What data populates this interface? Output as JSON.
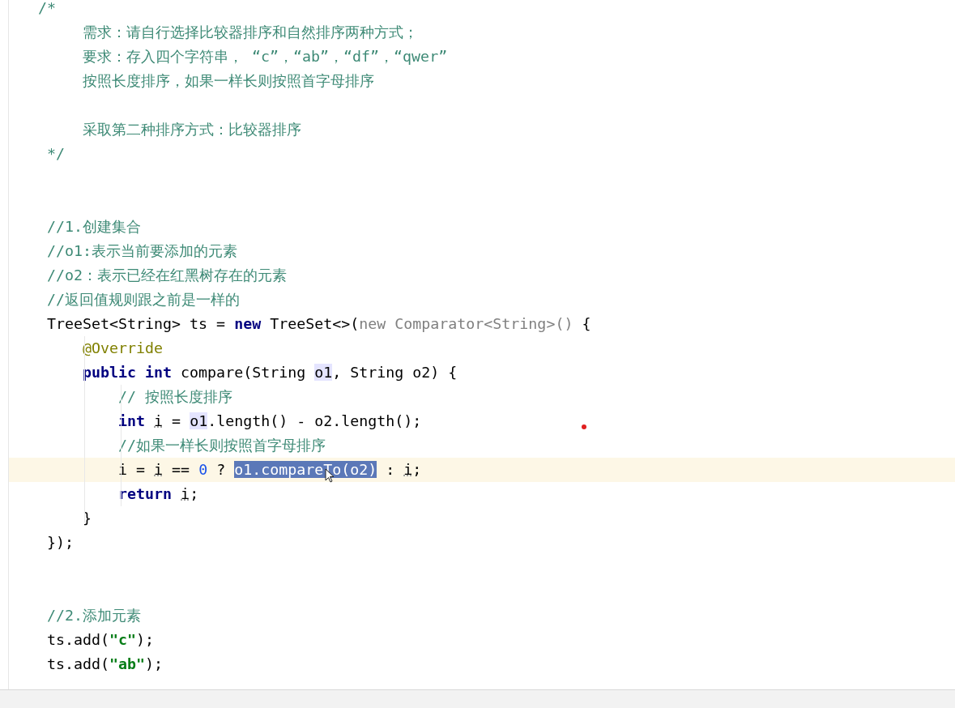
{
  "editor": {
    "lines": [
      {
        "kind": "code",
        "tokens": [
          {
            "kind": "comment",
            "text": "/*"
          }
        ]
      },
      {
        "kind": "code",
        "tokens": [
          {
            "kind": "comment",
            "text": "     需求：请自行选择比较器排序和自然排序两种方式；"
          }
        ]
      },
      {
        "kind": "code",
        "tokens": [
          {
            "kind": "comment",
            "text": "     要求：存入四个字符串， “c”，“ab”，“df”，“qwer”"
          }
        ]
      },
      {
        "kind": "code",
        "tokens": [
          {
            "kind": "comment",
            "text": "     按照长度排序，如果一样长则按照首字母排序"
          }
        ]
      },
      {
        "kind": "blank"
      },
      {
        "kind": "code",
        "tokens": [
          {
            "kind": "comment",
            "text": "     采取第二种排序方式：比较器排序"
          }
        ]
      },
      {
        "kind": "code",
        "tokens": [
          {
            "kind": "comment",
            "text": " */"
          }
        ]
      },
      {
        "kind": "blank"
      },
      {
        "kind": "blank"
      },
      {
        "kind": "code",
        "tokens": [
          {
            "kind": "comment",
            "text": " //1.创建集合"
          }
        ]
      },
      {
        "kind": "code",
        "tokens": [
          {
            "kind": "comment",
            "text": " //o1:表示当前要添加的元素"
          }
        ]
      },
      {
        "kind": "code",
        "tokens": [
          {
            "kind": "comment",
            "text": " //o2：表示已经在红黑树存在的元素"
          }
        ]
      },
      {
        "kind": "code",
        "tokens": [
          {
            "kind": "comment",
            "text": " //返回值规则跟之前是一样的"
          }
        ]
      },
      {
        "kind": "code",
        "tokens": [
          {
            "kind": "plain",
            "text": " TreeSet<String> ts = "
          },
          {
            "kind": "keyword",
            "text": "new"
          },
          {
            "kind": "plain",
            "text": " TreeSet<>("
          },
          {
            "kind": "dim",
            "text": "new Comparator<String>()"
          },
          {
            "kind": "plain",
            "text": " {"
          }
        ]
      },
      {
        "kind": "code",
        "tokens": [
          {
            "kind": "annotation",
            "text": "     @Override"
          }
        ]
      },
      {
        "kind": "code",
        "tokens": [
          {
            "kind": "keyword",
            "text": "     public int"
          },
          {
            "kind": "plain",
            "text": " compare(String "
          },
          {
            "kind": "usage",
            "text": "o1"
          },
          {
            "kind": "plain",
            "text": ", String o2) {"
          }
        ]
      },
      {
        "kind": "code",
        "tokens": [
          {
            "kind": "comment",
            "text": "         // 按照长度排序"
          }
        ]
      },
      {
        "kind": "code",
        "tokens": [
          {
            "kind": "keyword",
            "text": "         int "
          },
          {
            "kind": "var",
            "text": "i"
          },
          {
            "kind": "plain",
            "text": " = "
          },
          {
            "kind": "usage",
            "text": "o1"
          },
          {
            "kind": "plain",
            "text": ".length() - o2.length();"
          }
        ]
      },
      {
        "kind": "code",
        "tokens": [
          {
            "kind": "comment",
            "text": "         //如果一样长则按照首字母排序"
          }
        ]
      },
      {
        "kind": "code",
        "current": true,
        "tokens": [
          {
            "kind": "plain",
            "text": "         i = "
          },
          {
            "kind": "var",
            "text": "i"
          },
          {
            "kind": "plain",
            "text": " == "
          },
          {
            "kind": "number",
            "text": "0"
          },
          {
            "kind": "plain",
            "text": " ? "
          },
          {
            "kind": "selection",
            "text": "o1.compareTo(o2)"
          },
          {
            "kind": "plain",
            "text": " : "
          },
          {
            "kind": "var",
            "text": "i"
          },
          {
            "kind": "plain",
            "text": ";"
          }
        ]
      },
      {
        "kind": "code",
        "tokens": [
          {
            "kind": "keyword",
            "text": "         return "
          },
          {
            "kind": "var",
            "text": "i"
          },
          {
            "kind": "plain",
            "text": ";"
          }
        ]
      },
      {
        "kind": "code",
        "tokens": [
          {
            "kind": "plain",
            "text": "     }"
          }
        ]
      },
      {
        "kind": "code",
        "tokens": [
          {
            "kind": "plain",
            "text": " });"
          }
        ]
      },
      {
        "kind": "blank"
      },
      {
        "kind": "blank"
      },
      {
        "kind": "code",
        "tokens": [
          {
            "kind": "comment",
            "text": " //2.添加元素"
          }
        ]
      },
      {
        "kind": "code",
        "tokens": [
          {
            "kind": "plain",
            "text": " ts.add("
          },
          {
            "kind": "string",
            "text": "\"c\""
          },
          {
            "kind": "plain",
            "text": ");"
          }
        ]
      },
      {
        "kind": "code",
        "tokens": [
          {
            "kind": "plain",
            "text": " ts.add("
          },
          {
            "kind": "string",
            "text": "\"ab\""
          },
          {
            "kind": "plain",
            "text": ");"
          }
        ]
      }
    ]
  }
}
